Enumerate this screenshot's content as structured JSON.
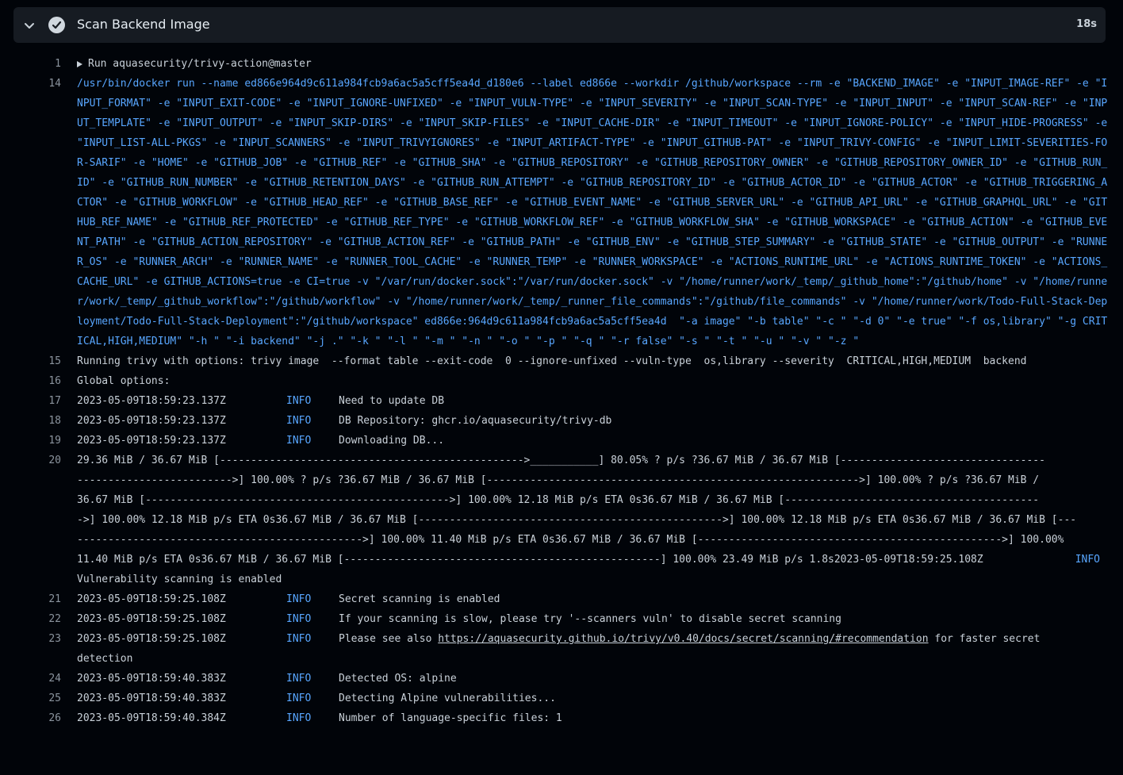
{
  "step": {
    "title": "Scan Backend Image",
    "duration": "18s"
  },
  "run_line": {
    "num": "1",
    "text": "Run aquasecurity/trivy-action@master"
  },
  "docker_cmd": {
    "num": "14",
    "text": "/usr/bin/docker run --name ed866e964d9c611a984fcb9a6ac5a5cff5ea4d_d180e6 --label ed866e --workdir /github/workspace --rm -e \"BACKEND_IMAGE\" -e \"INPUT_IMAGE-REF\" -e \"INPUT_FORMAT\" -e \"INPUT_EXIT-CODE\" -e \"INPUT_IGNORE-UNFIXED\" -e \"INPUT_VULN-TYPE\" -e \"INPUT_SEVERITY\" -e \"INPUT_SCAN-TYPE\" -e \"INPUT_INPUT\" -e \"INPUT_SCAN-REF\" -e \"INPUT_TEMPLATE\" -e \"INPUT_OUTPUT\" -e \"INPUT_SKIP-DIRS\" -e \"INPUT_SKIP-FILES\" -e \"INPUT_CACHE-DIR\" -e \"INPUT_TIMEOUT\" -e \"INPUT_IGNORE-POLICY\" -e \"INPUT_HIDE-PROGRESS\" -e \"INPUT_LIST-ALL-PKGS\" -e \"INPUT_SCANNERS\" -e \"INPUT_TRIVYIGNORES\" -e \"INPUT_ARTIFACT-TYPE\" -e \"INPUT_GITHUB-PAT\" -e \"INPUT_TRIVY-CONFIG\" -e \"INPUT_LIMIT-SEVERITIES-FOR-SARIF\" -e \"HOME\" -e \"GITHUB_JOB\" -e \"GITHUB_REF\" -e \"GITHUB_SHA\" -e \"GITHUB_REPOSITORY\" -e \"GITHUB_REPOSITORY_OWNER\" -e \"GITHUB_REPOSITORY_OWNER_ID\" -e \"GITHUB_RUN_ID\" -e \"GITHUB_RUN_NUMBER\" -e \"GITHUB_RETENTION_DAYS\" -e \"GITHUB_RUN_ATTEMPT\" -e \"GITHUB_REPOSITORY_ID\" -e \"GITHUB_ACTOR_ID\" -e \"GITHUB_ACTOR\" -e \"GITHUB_TRIGGERING_ACTOR\" -e \"GITHUB_WORKFLOW\" -e \"GITHUB_HEAD_REF\" -e \"GITHUB_BASE_REF\" -e \"GITHUB_EVENT_NAME\" -e \"GITHUB_SERVER_URL\" -e \"GITHUB_API_URL\" -e \"GITHUB_GRAPHQL_URL\" -e \"GITHUB_REF_NAME\" -e \"GITHUB_REF_PROTECTED\" -e \"GITHUB_REF_TYPE\" -e \"GITHUB_WORKFLOW_REF\" -e \"GITHUB_WORKFLOW_SHA\" -e \"GITHUB_WORKSPACE\" -e \"GITHUB_ACTION\" -e \"GITHUB_EVENT_PATH\" -e \"GITHUB_ACTION_REPOSITORY\" -e \"GITHUB_ACTION_REF\" -e \"GITHUB_PATH\" -e \"GITHUB_ENV\" -e \"GITHUB_STEP_SUMMARY\" -e \"GITHUB_STATE\" -e \"GITHUB_OUTPUT\" -e \"RUNNER_OS\" -e \"RUNNER_ARCH\" -e \"RUNNER_NAME\" -e \"RUNNER_TOOL_CACHE\" -e \"RUNNER_TEMP\" -e \"RUNNER_WORKSPACE\" -e \"ACTIONS_RUNTIME_URL\" -e \"ACTIONS_RUNTIME_TOKEN\" -e \"ACTIONS_CACHE_URL\" -e GITHUB_ACTIONS=true -e CI=true -v \"/var/run/docker.sock\":\"/var/run/docker.sock\" -v \"/home/runner/work/_temp/_github_home\":\"/github/home\" -v \"/home/runner/work/_temp/_github_workflow\":\"/github/workflow\" -v \"/home/runner/work/_temp/_runner_file_commands\":\"/github/file_commands\" -v \"/home/runner/work/Todo-Full-Stack-Deployment/Todo-Full-Stack-Deployment\":\"/github/workspace\" ed866e:964d9c611a984fcb9a6ac5a5cff5ea4d  \"-a image\" \"-b table\" \"-c \" \"-d 0\" \"-e true\" \"-f os,library\" \"-g CRITICAL,HIGH,MEDIUM\" \"-h \" \"-i backend\" \"-j .\" \"-k \" \"-l \" \"-m \" \"-n \" \"-o \" \"-p \" \"-q \" \"-r false\" \"-s \" \"-t \" \"-u \" \"-v \" \"-z \""
  },
  "plain_lines": [
    {
      "num": "15",
      "text": "Running trivy with options: trivy image  --format table --exit-code  0 --ignore-unfixed --vuln-type  os,library --severity  CRITICAL,HIGH,MEDIUM  backend"
    },
    {
      "num": "16",
      "text": "Global options:"
    }
  ],
  "info_lines_a": [
    {
      "num": "17",
      "ts": "2023-05-09T18:59:23.137Z",
      "level": "INFO",
      "msg": "Need to update DB"
    },
    {
      "num": "18",
      "ts": "2023-05-09T18:59:23.137Z",
      "level": "INFO",
      "msg": "DB Repository: ghcr.io/aquasecurity/trivy-db"
    },
    {
      "num": "19",
      "ts": "2023-05-09T18:59:23.137Z",
      "level": "INFO",
      "msg": "Downloading DB..."
    }
  ],
  "progress": {
    "num": "20",
    "rows": [
      "29.36 MiB / 36.67 MiB [------------------------------------------------->___________] 80.05% ? p/s ?36.67 MiB / 36.67 MiB [---------------------------------",
      "------------------------->] 100.00% ? p/s ?36.67 MiB / 36.67 MiB [------------------------------------------------------------>] 100.00% ? p/s ?36.67 MiB /",
      "36.67 MiB [------------------------------------------------->] 100.00% 12.18 MiB p/s ETA 0s36.67 MiB / 36.67 MiB [-----------------------------------------",
      "->] 100.00% 12.18 MiB p/s ETA 0s36.67 MiB / 36.67 MiB [------------------------------------------------->] 100.00% 12.18 MiB p/s ETA 0s36.67 MiB / 36.67 MiB [---",
      "---------------------------------------------->] 100.00% 11.40 MiB p/s ETA 0s36.67 MiB / 36.67 MiB [------------------------------------------------->] 100.00%",
      "11.40 MiB p/s ETA 0s36.67 MiB / 36.67 MiB [---------------------------------------------------] 100.00% 23.49 MiB p/s 1.8s2023-05-09T18:59:25.108Z"
    ],
    "trail_level": "INFO",
    "trail_msg": "Vulnerability scanning is enabled"
  },
  "info_lines_b": [
    {
      "num": "21",
      "ts": "2023-05-09T18:59:25.108Z",
      "level": "INFO",
      "msg": "Secret scanning is enabled"
    },
    {
      "num": "22",
      "ts": "2023-05-09T18:59:25.108Z",
      "level": "INFO",
      "msg": "If your scanning is slow, please try '--scanners vuln' to disable secret scanning"
    }
  ],
  "line23": {
    "num": "23",
    "ts": "2023-05-09T18:59:25.108Z",
    "level": "INFO",
    "pre": "Please see also ",
    "link": "https://aquasecurity.github.io/trivy/v0.40/docs/secret/scanning/#recommendation",
    "post": " for faster secret",
    "cont": "detection"
  },
  "info_lines_c": [
    {
      "num": "24",
      "ts": "2023-05-09T18:59:40.383Z",
      "level": "INFO",
      "msg": "Detected OS: alpine"
    },
    {
      "num": "25",
      "ts": "2023-05-09T18:59:40.383Z",
      "level": "INFO",
      "msg": "Detecting Alpine vulnerabilities..."
    },
    {
      "num": "26",
      "ts": "2023-05-09T18:59:40.384Z",
      "level": "INFO",
      "msg": "Number of language-specific files: 1"
    }
  ]
}
